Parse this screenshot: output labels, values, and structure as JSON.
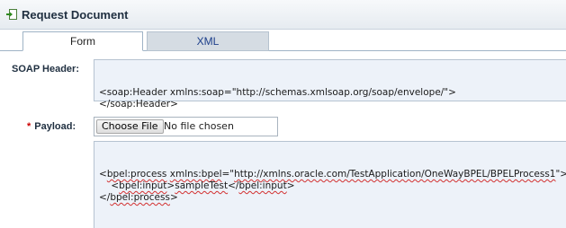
{
  "header": {
    "title": "Request Document",
    "icon": "insert-document-icon"
  },
  "tabs": [
    {
      "label": "Form",
      "active": true
    },
    {
      "label": "XML",
      "active": false
    }
  ],
  "soap_header": {
    "label": "SOAP Header:",
    "line1": "<soap:Header xmlns:soap=\"http://schemas.xmlsoap.org/soap/envelope/\">",
    "line2": "</soap:Header>"
  },
  "payload": {
    "required_marker": "*",
    "label": "Payload:",
    "choose_file_label": "Choose File",
    "file_status": "No file chosen",
    "xml": {
      "l1_a": "<",
      "l1_b": "bpel:process",
      "l1_c": " ",
      "l1_d": "xmlns:bpel",
      "l1_e": "=\"",
      "l1_f": "http://xmlns.oracle.com/TestApplication/OneWayBPEL/BPELProcess1",
      "l1_g": "\">",
      "l2_a": "    <",
      "l2_b": "bpel:input",
      "l2_c": ">",
      "l2_d": "sampleTest",
      "l2_e": "</",
      "l2_f": "bpel:input",
      "l2_g": ">",
      "l3_a": "</",
      "l3_b": "bpel:process",
      "l3_c": ">"
    }
  },
  "colors": {
    "accent": "#1c3e8a",
    "required": "#cc0000",
    "textarea_bg": "#edf2f9",
    "spellcheck": "#d23030"
  }
}
